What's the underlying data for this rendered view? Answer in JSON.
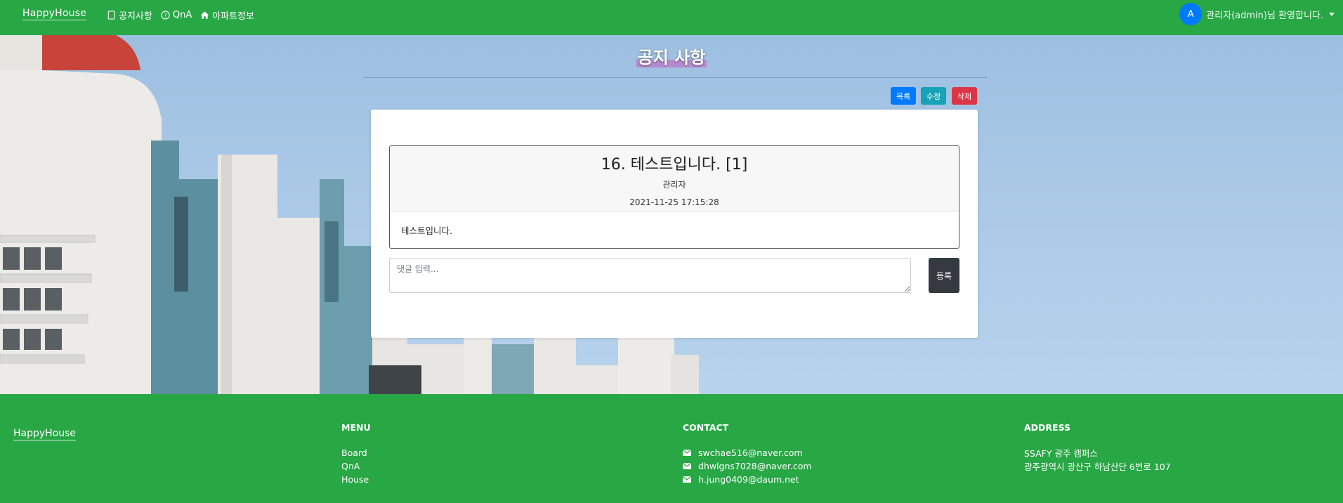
{
  "navbar": {
    "brand": "HappyHouse",
    "links": [
      {
        "label": "공지사항",
        "icon": "notice-icon"
      },
      {
        "label": "QnA",
        "icon": "question-circle-icon"
      },
      {
        "label": "아파트정보",
        "icon": "house-icon"
      }
    ],
    "user": {
      "avatar_letter": "A",
      "greeting": "관리자(admin)님 환영합니다."
    }
  },
  "page": {
    "title": "공지 사항",
    "buttons": {
      "list": "목록",
      "edit": "수정",
      "delete": "삭제"
    }
  },
  "post": {
    "title": "16. 테스트입니다. [1]",
    "author": "관리자",
    "date": "2021-11-25 17:15:28",
    "content": "테스트입니다."
  },
  "comment": {
    "placeholder": "댓글 입력...",
    "submit_label": "등록"
  },
  "footer": {
    "brand": "HappyHouse",
    "menu": {
      "heading": "MENU",
      "items": [
        "Board",
        "QnA",
        "House"
      ]
    },
    "contact": {
      "heading": "CONTACT",
      "emails": [
        "swchae516@naver.com",
        "dhwlgns7028@naver.com",
        "h.jung0409@daum.net"
      ]
    },
    "address": {
      "heading": "ADDRESS",
      "lines": [
        "SSAFY 광주 캠퍼스",
        "광주광역시 광산구 하남산단 6번로 107"
      ]
    }
  },
  "colors": {
    "navbar": "#28a745",
    "primary": "#007bff",
    "info": "#17a2b8",
    "danger": "#dc3545",
    "dark": "#343a40"
  }
}
